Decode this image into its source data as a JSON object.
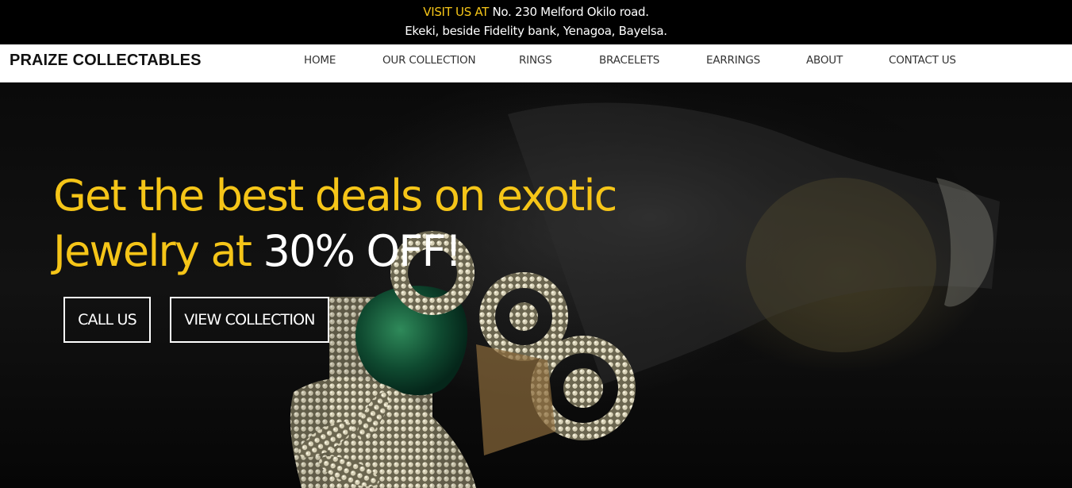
{
  "topbar": {
    "visit_label": "VISIT US AT",
    "address_line1": "No. 230 Melford Okilo road.",
    "address_line2": "Ekeki, beside Fidelity bank, Yenagoa, Bayelsa."
  },
  "nav": {
    "brand": "PRAIZE COLLECTABLES",
    "items": [
      {
        "label": "HOME"
      },
      {
        "label": "OUR COLLECTION"
      },
      {
        "label": "RINGS"
      },
      {
        "label": "BRACELETS"
      },
      {
        "label": "EARRINGS"
      },
      {
        "label": "ABOUT"
      },
      {
        "label": "CONTACT US"
      }
    ]
  },
  "hero": {
    "headline_part1": "Get the best deals on exotic",
    "headline_part2": "Jewelry at",
    "headline_highlight": "30% OFF!",
    "call_button": "CALL US",
    "view_button": "VIEW COLLECTION",
    "image_subject": "diamond ring with emerald stone on dark hand"
  },
  "colors": {
    "accent": "#f5c518",
    "topbar_bg": "#000000",
    "nav_bg": "#ffffff",
    "text_white": "#ffffff"
  }
}
